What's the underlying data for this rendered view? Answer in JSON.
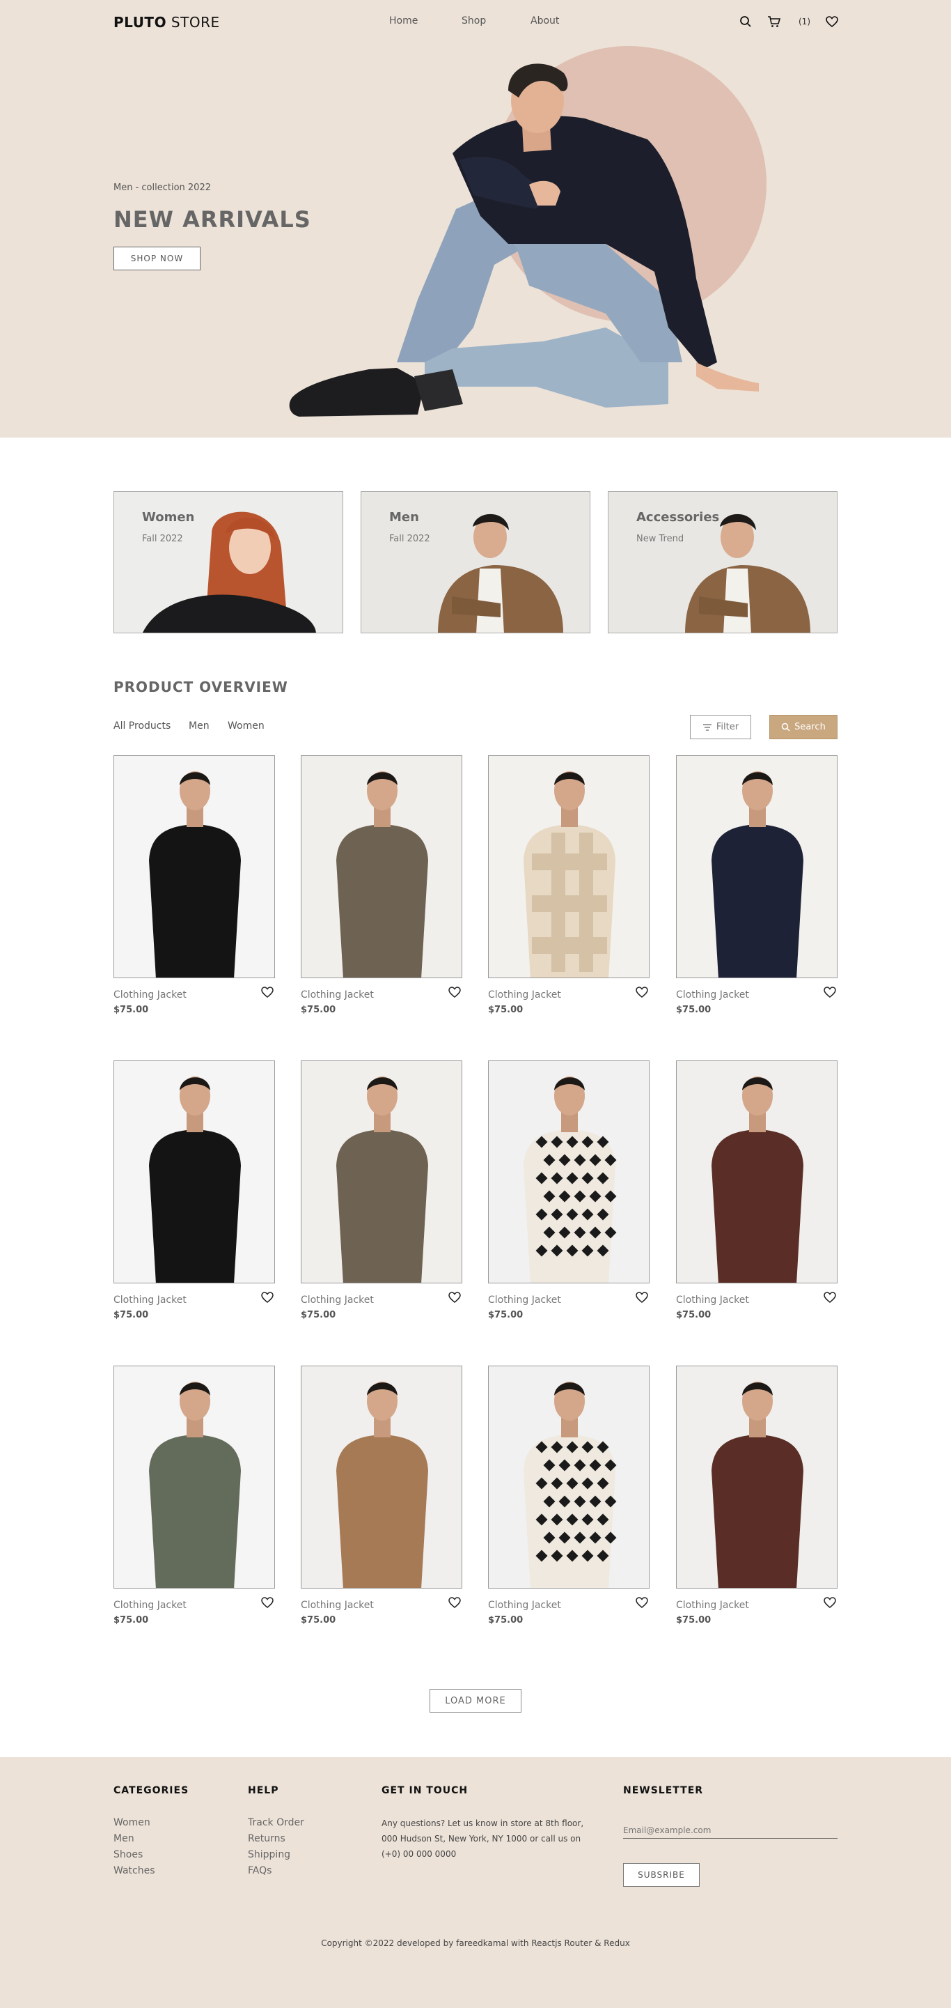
{
  "header": {
    "logo_bold": "PLUTO",
    "logo_light": " STORE",
    "nav": [
      "Home",
      "Shop",
      "About"
    ],
    "cart_count": "(1)",
    "icons": [
      "search-icon",
      "cart-icon",
      "heart-icon"
    ]
  },
  "hero": {
    "subtitle": "Men - collection 2022",
    "title": "NEW ARRIVALS",
    "button": "SHOP NOW"
  },
  "categories": [
    {
      "title": "Women",
      "subtitle": "Fall 2022"
    },
    {
      "title": "Men",
      "subtitle": "Fall 2022"
    },
    {
      "title": "Accessories",
      "subtitle": "New Trend"
    }
  ],
  "overview": {
    "title": "PRODUCT OVERVIEW",
    "tabs": [
      "All Products",
      "Men",
      "Women"
    ],
    "filter_label": "Filter",
    "search_label": "Search",
    "load_more": "LOAD MORE"
  },
  "products": [
    {
      "name": "Clothing Jacket",
      "price": "$75.00"
    },
    {
      "name": "Clothing Jacket",
      "price": "$75.00"
    },
    {
      "name": "Clothing Jacket",
      "price": "$75.00"
    },
    {
      "name": "Clothing Jacket",
      "price": "$75.00"
    },
    {
      "name": "Clothing Jacket",
      "price": "$75.00"
    },
    {
      "name": "Clothing Jacket",
      "price": "$75.00"
    },
    {
      "name": "Clothing Jacket",
      "price": "$75.00"
    },
    {
      "name": "Clothing Jacket",
      "price": "$75.00"
    },
    {
      "name": "Clothing Jacket",
      "price": "$75.00"
    },
    {
      "name": "Clothing Jacket",
      "price": "$75.00"
    },
    {
      "name": "Clothing Jacket",
      "price": "$75.00"
    },
    {
      "name": "Clothing Jacket",
      "price": "$75.00"
    }
  ],
  "footer": {
    "categories_title": "CATEGORIES",
    "categories": [
      "Women",
      "Men",
      "Shoes",
      "Watches"
    ],
    "help_title": "HELP",
    "help": [
      "Track Order",
      "Returns",
      "Shipping",
      "FAQs"
    ],
    "contact_title": "GET IN TOUCH",
    "contact_text": "Any questions? Let us know in store at 8th floor, 000 Hudson St, New York, NY 1000 or call us on (+0) 00 000 0000",
    "newsletter_title": "NEWSLETTER",
    "email_placeholder": "Email@example.com",
    "subscribe": "SUBSRIBE",
    "copyright": "Copyright ©2022 developed by fareedkamal with Reactjs Router & Redux"
  },
  "colors": {
    "beige": "#ece2d8",
    "accent": "#c9a77f",
    "circle": "#dfc0b3"
  }
}
